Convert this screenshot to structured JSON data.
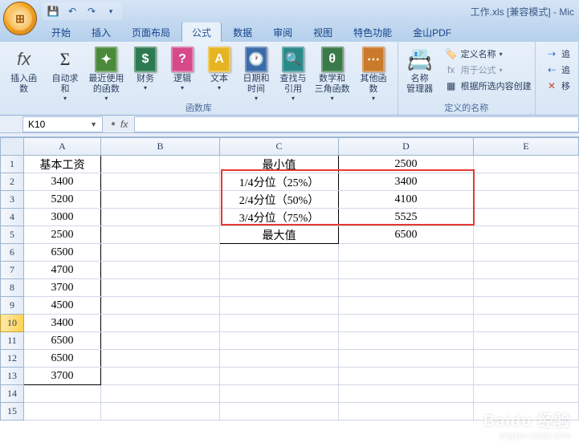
{
  "title": "工作.xls [兼容模式] - Mic",
  "tabs": [
    "开始",
    "插入",
    "页面布局",
    "公式",
    "数据",
    "审阅",
    "视图",
    "特色功能",
    "金山PDF"
  ],
  "active_tab": 3,
  "ribbon": {
    "insert_fn": "插入函数",
    "autosum": "自动求和",
    "recent": "最近使用\n的函数",
    "financial": "财务",
    "logical": "逻辑",
    "text": "文本",
    "datetime": "日期和\n时间",
    "lookup": "查找与\n引用",
    "math": "数学和\n三角函数",
    "other": "其他函数",
    "group_lib": "函数库",
    "name_mgr": "名称\n管理器",
    "def_name": "定义名称",
    "use_formula": "用于公式",
    "create_sel": "根据所选内容创建",
    "group_names": "定义的名称",
    "trace_prec": "追",
    "trace_dep": "追",
    "remove_arrows": "移"
  },
  "name_box": "K10",
  "columns": [
    "A",
    "B",
    "C",
    "D",
    "E"
  ],
  "rows": [
    {
      "n": 1,
      "A": "基本工资",
      "C": "最小值",
      "D": "2500"
    },
    {
      "n": 2,
      "A": "3400",
      "C": "1/4分位（25%）",
      "D": "3400"
    },
    {
      "n": 3,
      "A": "5200",
      "C": "2/4分位（50%）",
      "D": "4100"
    },
    {
      "n": 4,
      "A": "3000",
      "C": "3/4分位（75%）",
      "D": "5525"
    },
    {
      "n": 5,
      "A": "2500",
      "C": "最大值",
      "D": "6500"
    },
    {
      "n": 6,
      "A": "6500"
    },
    {
      "n": 7,
      "A": "4700"
    },
    {
      "n": 8,
      "A": "3700"
    },
    {
      "n": 9,
      "A": "4500"
    },
    {
      "n": 10,
      "A": "3400"
    },
    {
      "n": 11,
      "A": "6500"
    },
    {
      "n": 12,
      "A": "6500"
    },
    {
      "n": 13,
      "A": "3700"
    },
    {
      "n": 14
    },
    {
      "n": 15
    }
  ],
  "watermark": {
    "brand": "Baidu 经验",
    "url": "jingyan.baidu.com"
  }
}
